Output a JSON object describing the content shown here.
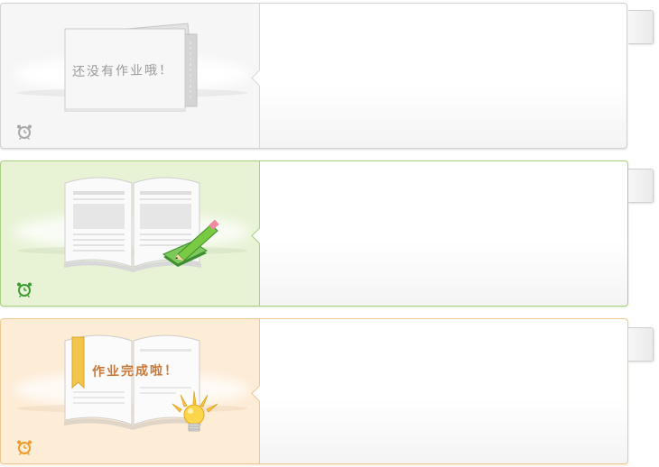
{
  "cards": [
    {
      "state": "empty",
      "message": "还没有作业哦！",
      "icon": "clock-icon",
      "accent": "#9e9e9e"
    },
    {
      "state": "in-progress",
      "message": "",
      "icon": "clock-icon",
      "accent": "#4fa83a"
    },
    {
      "state": "completed",
      "message": "作业完成啦！",
      "icon": "clock-icon",
      "accent": "#f09a2a"
    }
  ],
  "colors": {
    "gray_bg": "#f6f6f6",
    "green_bg": "#e8f3d6",
    "orange_bg": "#fdecd6",
    "green_border": "#a8cf82",
    "orange_border": "#efc993"
  }
}
